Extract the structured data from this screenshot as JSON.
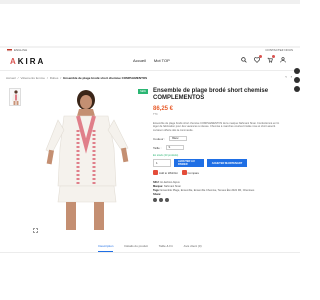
{
  "utility_bar": {
    "left": "ENGLISH",
    "right": "CONTACTEZ NOUS"
  },
  "header": {
    "logo_a": "A",
    "logo_rest": "KIRA",
    "nav": [
      "Accueil",
      "Mot TOP"
    ]
  },
  "breadcrumb": {
    "items": [
      "Accueil",
      "Vêtements femme",
      "Robes"
    ],
    "current": "Ensemble de plage brodé short chemise COMPLEMENTOS"
  },
  "pager": [
    "‹",
    "›"
  ],
  "product": {
    "badge": "NEW",
    "title": "Ensemble de plage brodé short chemise COMPLEMENTOS",
    "price": "86,25 €",
    "tax": "TTC",
    "description": "Ensemble de plage brodé short chemise COMPLEMENTOS de la marque Nahmani Sinai. Confectionné en lin léger de fabrication pour des vacances à vitesse. Chemise à manches courtes brodée rose et short assorti. Livraison offerte dès la commande.",
    "color_label": "Couleur :",
    "color_value": "Blanc",
    "size_label": "Taille :",
    "size_value": "S",
    "stock_text": "En stock (43 produits)",
    "quantity_value": "1",
    "button_a": "AJOUTER AU PANIER",
    "button_b": "ACHETER MAINTENANT",
    "wishlist": "Add to Wishlist",
    "compare": "Compare",
    "sku_label": "SKU:",
    "sku_value": "Iot-fashion-bijoux",
    "brand_label": "Marque:",
    "brand_value": "Nahmani Sinai",
    "tags_label": "Tags:",
    "tags_value": "Ensemble Plage, Ensemble, Ensemble Chemise, Tenues Été 2022 FR, Chemises",
    "share_label": "Share:"
  },
  "tabs": [
    "Description",
    "Détails du produit",
    "Taille & Fit",
    "Avis client (0)"
  ]
}
